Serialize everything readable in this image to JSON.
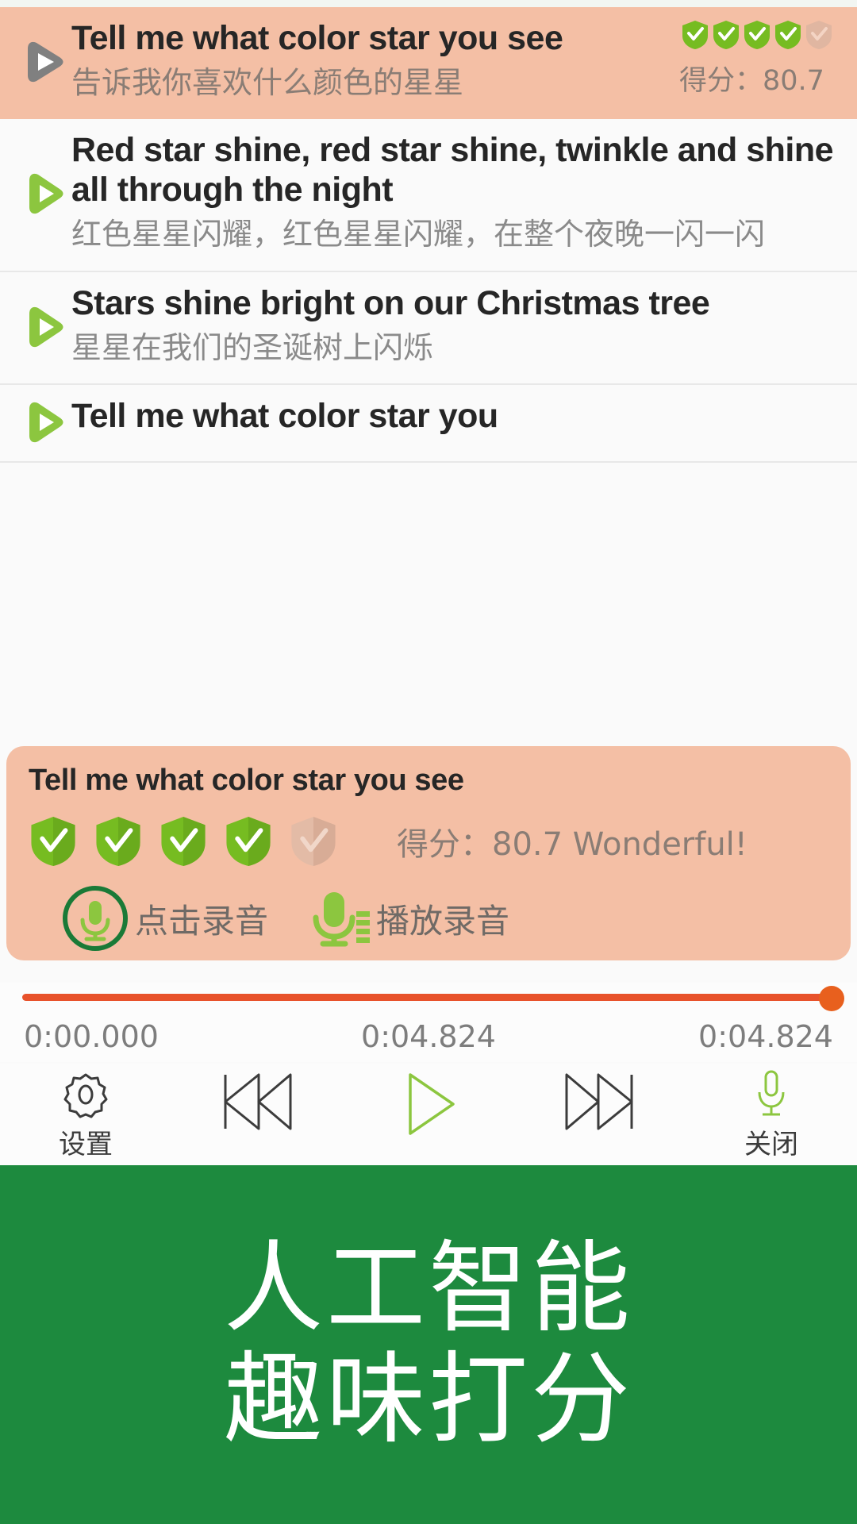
{
  "list": {
    "items": [
      {
        "english": "Tell me what color star you see",
        "chinese": "告诉我你喜欢什么颜色的星星",
        "active": true,
        "shields_filled": 4,
        "shields_total": 5,
        "score_label": "得分：80.7"
      },
      {
        "english": "Red star shine, red star shine, twinkle and shine all through the night",
        "chinese": "红色星星闪耀，红色星星闪耀，在整个夜晚一闪一闪",
        "active": false
      },
      {
        "english": "Stars shine bright on our Christmas tree",
        "chinese": "星星在我们的圣诞树上闪烁",
        "active": false
      },
      {
        "english": "Tell me what color star you",
        "chinese": "",
        "active": false
      }
    ]
  },
  "score_panel": {
    "title": "Tell me what color star you see",
    "shields_filled": 4,
    "shields_total": 5,
    "score_text": "得分：80.7 Wonderful!",
    "record_button_label": "点击录音",
    "play_record_button_label": "播放录音"
  },
  "progress": {
    "current_time": "0:00.000",
    "center_time": "0:04.824",
    "total_time": "0:04.824",
    "percent": 100
  },
  "toolbar": {
    "items": [
      {
        "icon": "gear-icon",
        "label": "设置"
      },
      {
        "icon": "previous-track-icon",
        "label": ""
      },
      {
        "icon": "play-icon",
        "label": ""
      },
      {
        "icon": "next-track-icon",
        "label": ""
      },
      {
        "icon": "microphone-icon",
        "label": "关闭"
      }
    ]
  },
  "banner": {
    "line1": "人工智能",
    "line2": "趣味打分"
  },
  "colors": {
    "accent_peach": "#f4bfa5",
    "shield_green": "#76bc21",
    "shield_empty": "#e0b6a1",
    "progress_orange": "#e8522b",
    "banner_green": "#1d8a3e",
    "play_green": "#8cc63f",
    "record_ring_green": "#1a7a37"
  }
}
